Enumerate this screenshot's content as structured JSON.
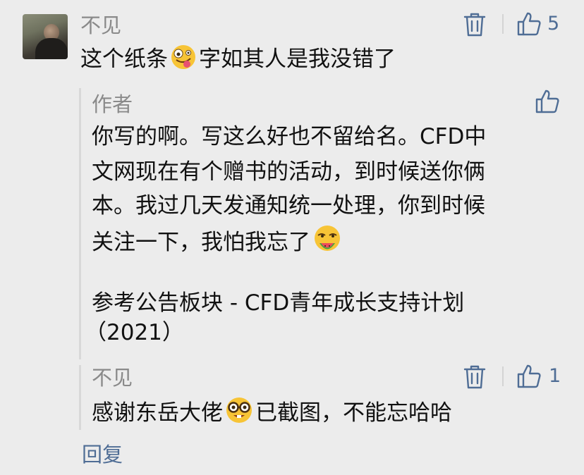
{
  "comment": {
    "author": "不见",
    "text_before": "这个纸条",
    "text_after": "字如其人是我没错了",
    "like_count": "5"
  },
  "author_reply": {
    "label": "作者",
    "line1": "你写的啊。写这么好也不留给名。CFD中",
    "line2": "文网现在有个赠书的活动，到时候送你俩",
    "line3": "本。我过几天发通知统一处理，你到时候",
    "line4": "关注一下，我怕我忘了",
    "line5": "参考公告板块 - CFD青年成长支持计划",
    "line6": "（2021）"
  },
  "sub_reply": {
    "author": "不见",
    "text_before": "感谢东岳大佬",
    "text_after": "已截图，不能忘哈哈",
    "like_count": "1"
  },
  "reply_link": "回复",
  "icons": {
    "delete": "trash-icon",
    "like": "thumbs-up-icon",
    "emoji1": "zany-face-emoji",
    "emoji2": "watermelon-face-emoji",
    "emoji3": "nerd-face-emoji"
  },
  "colors": {
    "accent": "#4f6d95",
    "name": "#8a8a8a",
    "background": "#ececec"
  }
}
